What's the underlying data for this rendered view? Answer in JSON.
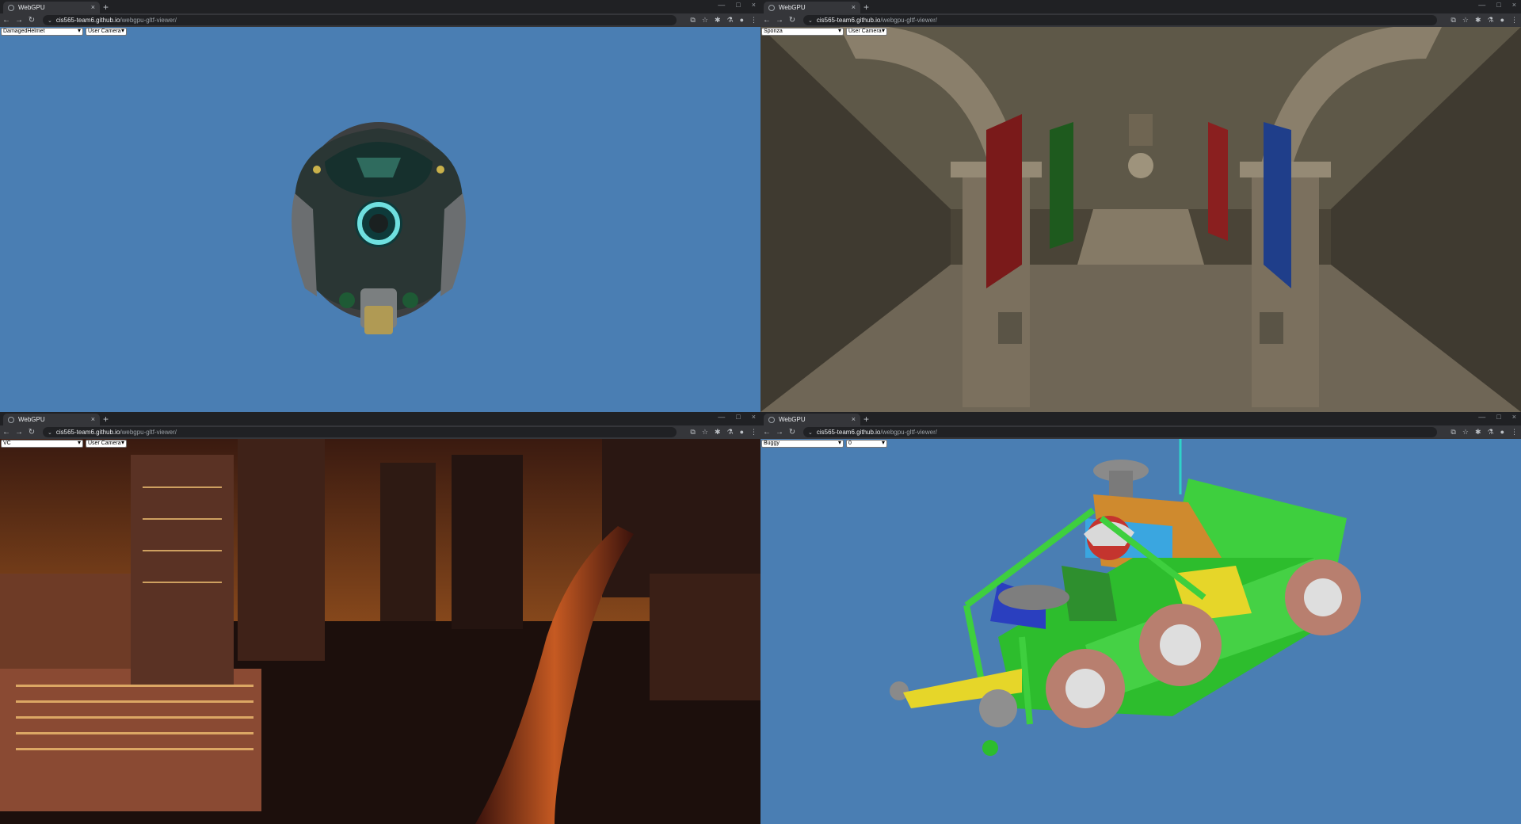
{
  "windows": [
    {
      "tab_title": "WebGPU",
      "url_host": "cis565-team6.github.io",
      "url_path": "/webgpu-gltf-viewer/",
      "model_select": "DamagedHelmet",
      "camera_select": "User Camera",
      "scene_bg": "#4a7eb3"
    },
    {
      "tab_title": "WebGPU",
      "url_host": "cis565-team6.github.io",
      "url_path": "/webgpu-gltf-viewer/",
      "model_select": "Sponza",
      "camera_select": "User Camera",
      "scene_bg": "#4a4437"
    },
    {
      "tab_title": "WebGPU",
      "url_host": "cis565-team6.github.io",
      "url_path": "/webgpu-gltf-viewer/",
      "model_select": "VC",
      "camera_select": "User Camera",
      "scene_bg": "#2a1410"
    },
    {
      "tab_title": "WebGPU",
      "url_host": "cis565-team6.github.io",
      "url_path": "/webgpu-gltf-viewer/",
      "model_select": "Buggy",
      "camera_select": "0",
      "scene_bg": "#4a7eb3"
    }
  ],
  "icons": {
    "close": "×",
    "new_tab": "+",
    "back": "←",
    "forward": "→",
    "reload": "↻",
    "minimize": "—",
    "maximize": "□",
    "window_close": "×",
    "site_info": "⌄",
    "menu": "⋮"
  }
}
